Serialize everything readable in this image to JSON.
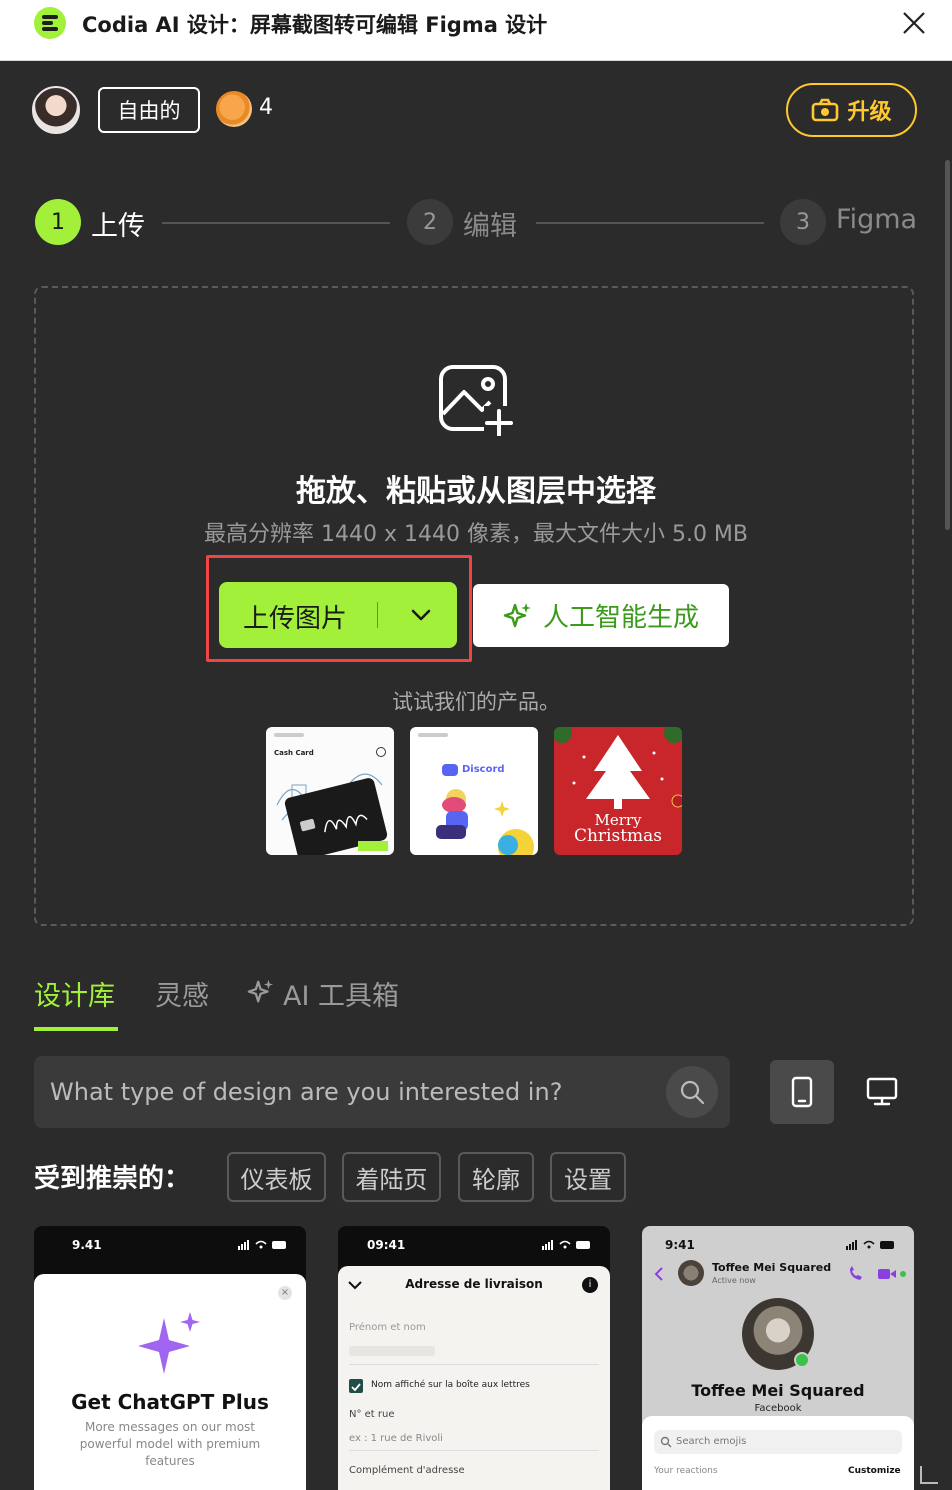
{
  "window": {
    "title": "Codia AI 设计：屏幕截图转可编辑 Figma 设计"
  },
  "header": {
    "plan": "自由的",
    "credits": "4",
    "upgrade": "升级"
  },
  "steps": [
    {
      "num": "1",
      "label": "上传"
    },
    {
      "num": "2",
      "label": "编辑"
    },
    {
      "num": "3",
      "label": "Figma"
    }
  ],
  "upload": {
    "title": "拖放、粘贴或从图层中选择",
    "subtitle": "最高分辨率 1440 x 1440 像素，最大文件大小 5.0 MB",
    "upload_button": "上传图片",
    "ai_button": "人工智能生成",
    "try_text": "试试我们的产品。",
    "samples": [
      {
        "text": "Cash Card"
      },
      {
        "text": "Discord"
      },
      {
        "text_1": "Merry",
        "text_2": "Christmas"
      }
    ]
  },
  "tabs": [
    {
      "label": "设计库"
    },
    {
      "label": "灵感"
    },
    {
      "label": "AI 工具箱"
    }
  ],
  "search": {
    "placeholder": "What type of design are you interested in?"
  },
  "featured": {
    "label": "受到推崇的：",
    "chips": [
      "仪表板",
      "着陆页",
      "轮廓",
      "设置"
    ]
  },
  "cards": [
    {
      "time": "9.41",
      "title": "Get ChatGPT Plus",
      "body_1": "More messages on our most",
      "body_2": "powerful model with premium",
      "body_3": "features"
    },
    {
      "time": "09:41",
      "title": "Adresse de livraison",
      "field_1": "Prénom et nom",
      "checkbox": "Nom affiché sur la boîte aux lettres",
      "field_2": "N° et rue",
      "placeholder_2": "ex : 1 rue de Rivoli",
      "field_3": "Complément d'adresse"
    },
    {
      "time": "9:41",
      "contact": "Toffee Mei Squared",
      "status": "Active now",
      "name": "Toffee Mei Squared",
      "source": "Facebook",
      "search": "Search emojis",
      "reactions": "Your reactions",
      "customize": "Customize"
    }
  ],
  "colors": {
    "accent": "#a3f03a",
    "upgrade": "#ffc82e",
    "highlight": "#f04545",
    "background": "#2b2b2b"
  }
}
